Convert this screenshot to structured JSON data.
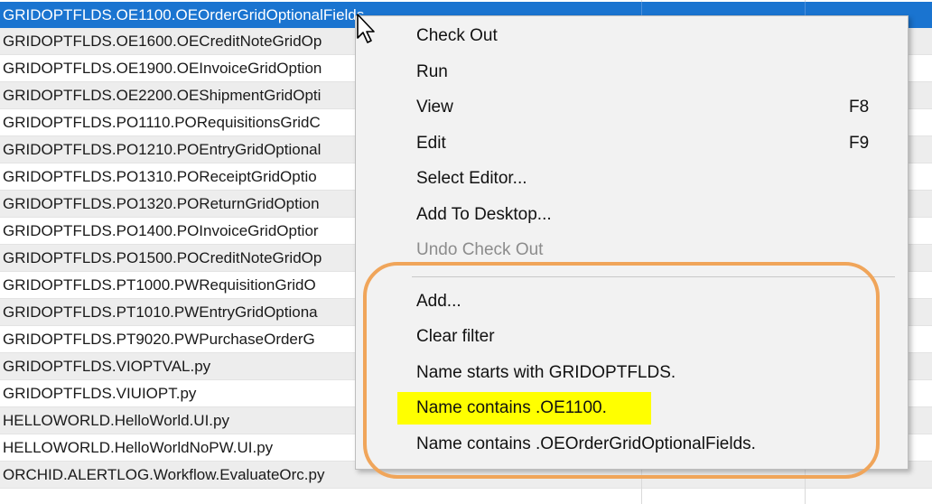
{
  "files": [
    {
      "name": "GRIDOPTFLDS.OE1100.OEOrderGridOptionalFields",
      "selected": true
    },
    {
      "name": "GRIDOPTFLDS.OE1600.OECreditNoteGridOp"
    },
    {
      "name": "GRIDOPTFLDS.OE1900.OEInvoiceGridOption"
    },
    {
      "name": "GRIDOPTFLDS.OE2200.OEShipmentGridOpti"
    },
    {
      "name": "GRIDOPTFLDS.PO1110.PORequisitionsGridC"
    },
    {
      "name": "GRIDOPTFLDS.PO1210.POEntryGridOptional"
    },
    {
      "name": "GRIDOPTFLDS.PO1310.POReceiptGridOptio"
    },
    {
      "name": "GRIDOPTFLDS.PO1320.POReturnGridOption"
    },
    {
      "name": "GRIDOPTFLDS.PO1400.POInvoiceGridOptior"
    },
    {
      "name": "GRIDOPTFLDS.PO1500.POCreditNoteGridOp"
    },
    {
      "name": "GRIDOPTFLDS.PT1000.PWRequisitionGridO"
    },
    {
      "name": "GRIDOPTFLDS.PT1010.PWEntryGridOptiona"
    },
    {
      "name": "GRIDOPTFLDS.PT9020.PWPurchaseOrderG"
    },
    {
      "name": "GRIDOPTFLDS.VIOPTVAL.py"
    },
    {
      "name": "GRIDOPTFLDS.VIUIOPT.py"
    },
    {
      "name": "HELLOWORLD.HelloWorld.UI.py"
    },
    {
      "name": "HELLOWORLD.HelloWorldNoPW.UI.py"
    },
    {
      "name": "ORCHID.ALERTLOG.Workflow.EvaluateOrc.py"
    }
  ],
  "context_menu": {
    "items": [
      {
        "label": "Check Out",
        "key": "",
        "disabled": false
      },
      {
        "label": "Run",
        "key": "",
        "disabled": false
      },
      {
        "label": "View",
        "key": "F8",
        "disabled": false
      },
      {
        "label": "Edit",
        "key": "F9",
        "disabled": false
      },
      {
        "label": "Select Editor...",
        "key": "",
        "disabled": false
      },
      {
        "label": "Add To Desktop...",
        "key": "",
        "disabled": false
      },
      {
        "label": "Undo Check Out",
        "key": "",
        "disabled": true
      },
      {
        "label": "Add...",
        "key": "",
        "disabled": false
      },
      {
        "label": "Clear filter",
        "key": "",
        "disabled": false
      },
      {
        "label": "Name starts with GRIDOPTFLDS.",
        "key": "",
        "disabled": false
      },
      {
        "label": "Name contains .OE1100.",
        "key": "",
        "disabled": false,
        "highlighted": true
      },
      {
        "label": "Name contains .OEOrderGridOptionalFields.",
        "key": "",
        "disabled": false
      }
    ]
  },
  "colors": {
    "selection": "#1a74d0",
    "highlight": "#ffff00",
    "annotation_outline": "#f0a55a"
  },
  "cursor_icon": "mouse-pointer-icon"
}
